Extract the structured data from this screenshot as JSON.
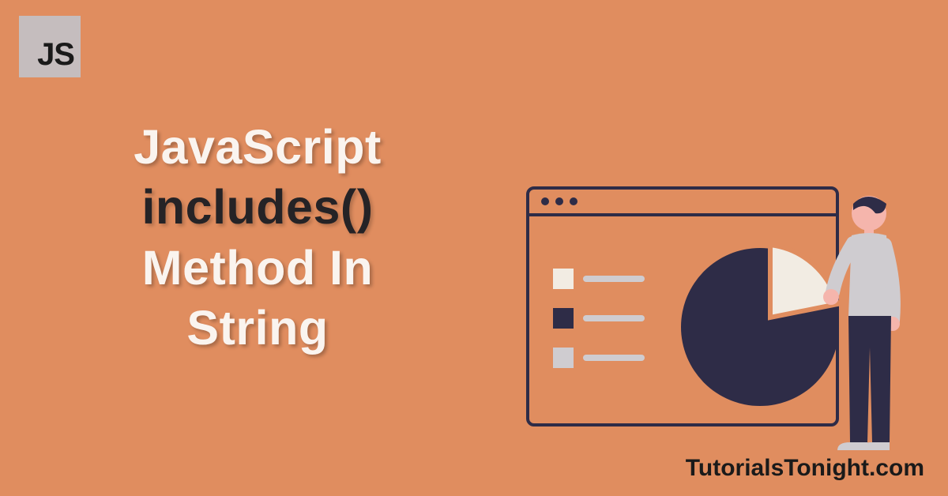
{
  "badge": {
    "label": "JS"
  },
  "heading": {
    "line1": "JavaScript",
    "line2": "includes()",
    "line3": "Method In",
    "line4": "String"
  },
  "footer": {
    "site": "TutorialsTonight.com"
  },
  "colors": {
    "background": "#e08d5f",
    "badge_bg": "#c5bdbe",
    "dark": "#252326",
    "white": "#faf4ef",
    "navy": "#2e2c47",
    "light_gray": "#cfccd0",
    "cream": "#f2ece3",
    "skin": "#f5b5ac"
  }
}
